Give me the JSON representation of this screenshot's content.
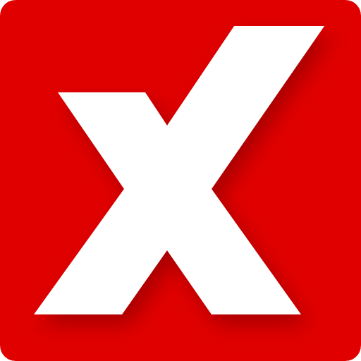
{
  "icon": {
    "name": "x-logo-icon",
    "background_color": "#E00000",
    "glyph_color": "#FFFFFF",
    "shadow_color": "#7A0000"
  }
}
